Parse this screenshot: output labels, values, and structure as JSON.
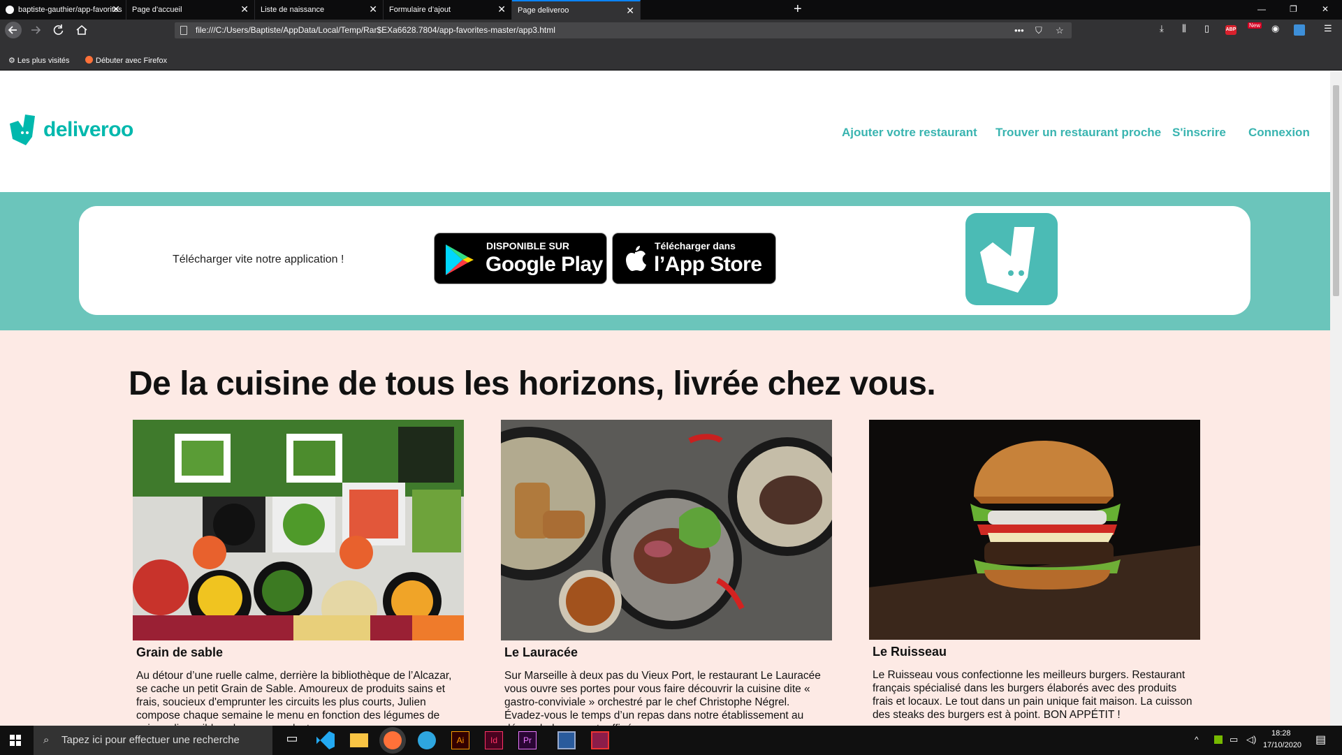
{
  "browser": {
    "tabs": [
      {
        "title": "baptiste-gauthier/app-favorites",
        "active": false
      },
      {
        "title": "Page d’accueil",
        "active": false
      },
      {
        "title": "Liste de naissance",
        "active": false
      },
      {
        "title": "Formulaire d’ajout",
        "active": false
      },
      {
        "title": "Page deliveroo",
        "active": true
      }
    ],
    "new_tab": "+",
    "close_glyph": "✕",
    "url": "file:///C:/Users/Baptiste/AppData/Local/Temp/Rar$EXa6628.7804/app-favorites-master/app3.html",
    "bookmarks": [
      "Les plus visités",
      "Débuter avec Firefox"
    ],
    "addon_badge": "New",
    "abp_label": "ABP"
  },
  "site": {
    "logo_text": "deliveroo",
    "nav": [
      "Ajouter votre restaurant",
      "Trouver un restaurant proche",
      "S'inscrire",
      "Connexion"
    ],
    "banner": {
      "text": "Télécharger vite notre application !",
      "google_small": "DISPONIBLE SUR",
      "google_big": "Google Play",
      "apple_small": "Télécharger dans",
      "apple_big": "l’App Store"
    },
    "headline": "De la cuisine de tous les horizons, livrée chez vous.",
    "restaurants": [
      {
        "name": "Grain de sable",
        "description": "Au détour d’une ruelle calme, derrière la bibliothèque de l’Alcazar, se cache un petit Grain de Sable. Amoureux de produits sains et frais, soucieux d'emprunter les circuits les plus courts, Julien compose chaque semaine le menu en fonction des légumes de saison disponibles chez ses producteurs."
      },
      {
        "name": "Le Lauracée",
        "description": "Sur Marseille à deux pas du Vieux Port, le restaurant Le Lauracée vous ouvre ses portes pour vous faire découvrir la cuisine dite « gastro-conviviale » orchestré par le chef Christophe Négrel. Évadez-vous le temps d’un repas dans notre établissement au décor chaleureux et raffiné."
      },
      {
        "name": "Le Ruisseau",
        "description": "Le Ruisseau vous confectionne les meilleurs burgers. Restaurant français spécialisé dans les burgers élaborés avec des produits frais et locaux. Le tout dans un pain unique fait maison. La cuisson des steaks des burgers est à point. BON APPÉTIT !"
      }
    ]
  },
  "taskbar": {
    "search_placeholder": "Tapez ici pour effectuer une recherche",
    "apps": [
      "task-view",
      "vscode",
      "file-explorer",
      "firefox",
      "telegram",
      "illustrator",
      "indesign",
      "premiere",
      "calculator",
      "winrar"
    ],
    "app_labels": {
      "illustrator": "Ai",
      "indesign": "Id",
      "premiere": "Pr"
    },
    "time": "18:28",
    "date": "17/10/2020"
  },
  "colors": {
    "brand": "#00b8ad",
    "nav": "#39b4b0",
    "banner": "#6bc5bb",
    "page_bg": "#fdeae5"
  }
}
